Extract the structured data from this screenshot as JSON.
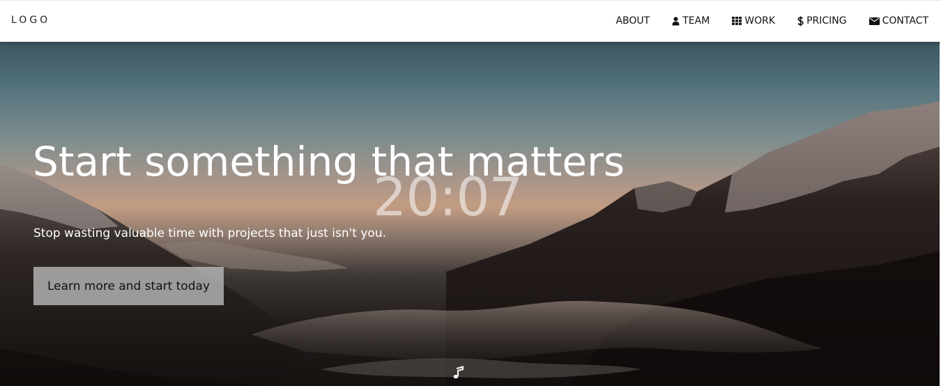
{
  "header": {
    "logo": "LOGO",
    "nav": [
      {
        "label": "ABOUT",
        "icon": ""
      },
      {
        "label": "TEAM",
        "icon": "user-icon"
      },
      {
        "label": "WORK",
        "icon": "grid-icon"
      },
      {
        "label": "PRICING",
        "icon": "dollar-icon"
      },
      {
        "label": "CONTACT",
        "icon": "envelope-icon"
      }
    ]
  },
  "hero": {
    "headline": "Start something that matters",
    "clock": "20:07",
    "subline": "Stop wasting valuable time with projects that just isn't you.",
    "cta_label": "Learn more and start today",
    "music_icon": "music-note-icon"
  },
  "colors": {
    "header_bg": "#ffffff",
    "hero_text": "#ffffff",
    "cta_bg": "#bebebe"
  }
}
